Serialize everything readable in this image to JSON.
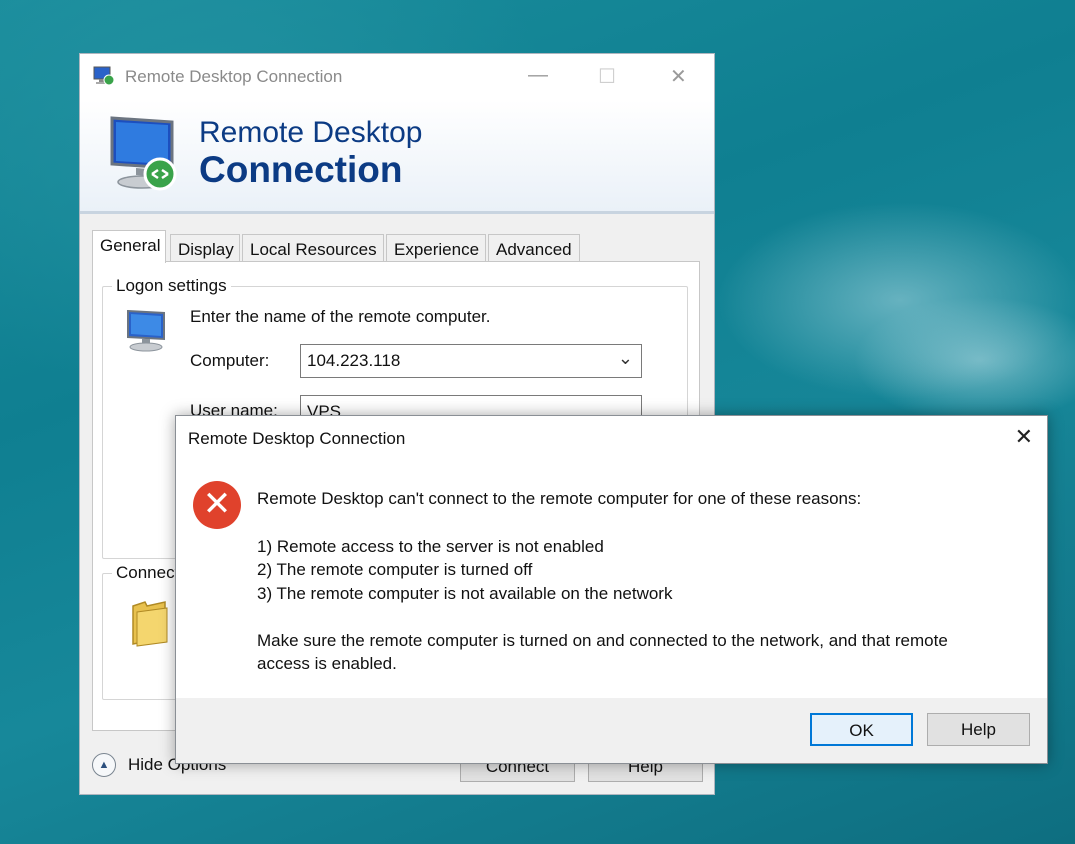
{
  "main_window": {
    "title": "Remote Desktop Connection",
    "minimize_glyph": "—",
    "maximize_glyph": "☐",
    "close_glyph": "✕",
    "banner_line1": "Remote Desktop",
    "banner_line2": "Connection",
    "tabs": [
      {
        "label": "General",
        "active": true
      },
      {
        "label": "Display"
      },
      {
        "label": "Local Resources"
      },
      {
        "label": "Experience"
      },
      {
        "label": "Advanced"
      }
    ],
    "logon_group": {
      "title": "Logon settings",
      "prompt": "Enter the name of the remote computer.",
      "computer_label": "Computer:",
      "computer_value": "104.223.118",
      "username_label": "User name:",
      "username_value": "VPS"
    },
    "connection_group": {
      "title": "Connect"
    },
    "hide_options": "Hide Options",
    "connect_button": "Connect",
    "help_button": "Help"
  },
  "error_dialog": {
    "title": "Remote Desktop Connection",
    "close_glyph": "✕",
    "icon": "error-icon",
    "icon_color": "#e0422c",
    "heading": "Remote Desktop can't connect to the remote computer for one of these reasons:",
    "reasons": [
      "1) Remote access to the server is not enabled",
      "2) The remote computer is turned off",
      "3) The remote computer is not available on the network"
    ],
    "advice_line1": "Make sure the remote computer is turned on and connected to the network, and that remote",
    "advice_line2": "access is enabled.",
    "ok_button": "OK",
    "help_button": "Help"
  }
}
